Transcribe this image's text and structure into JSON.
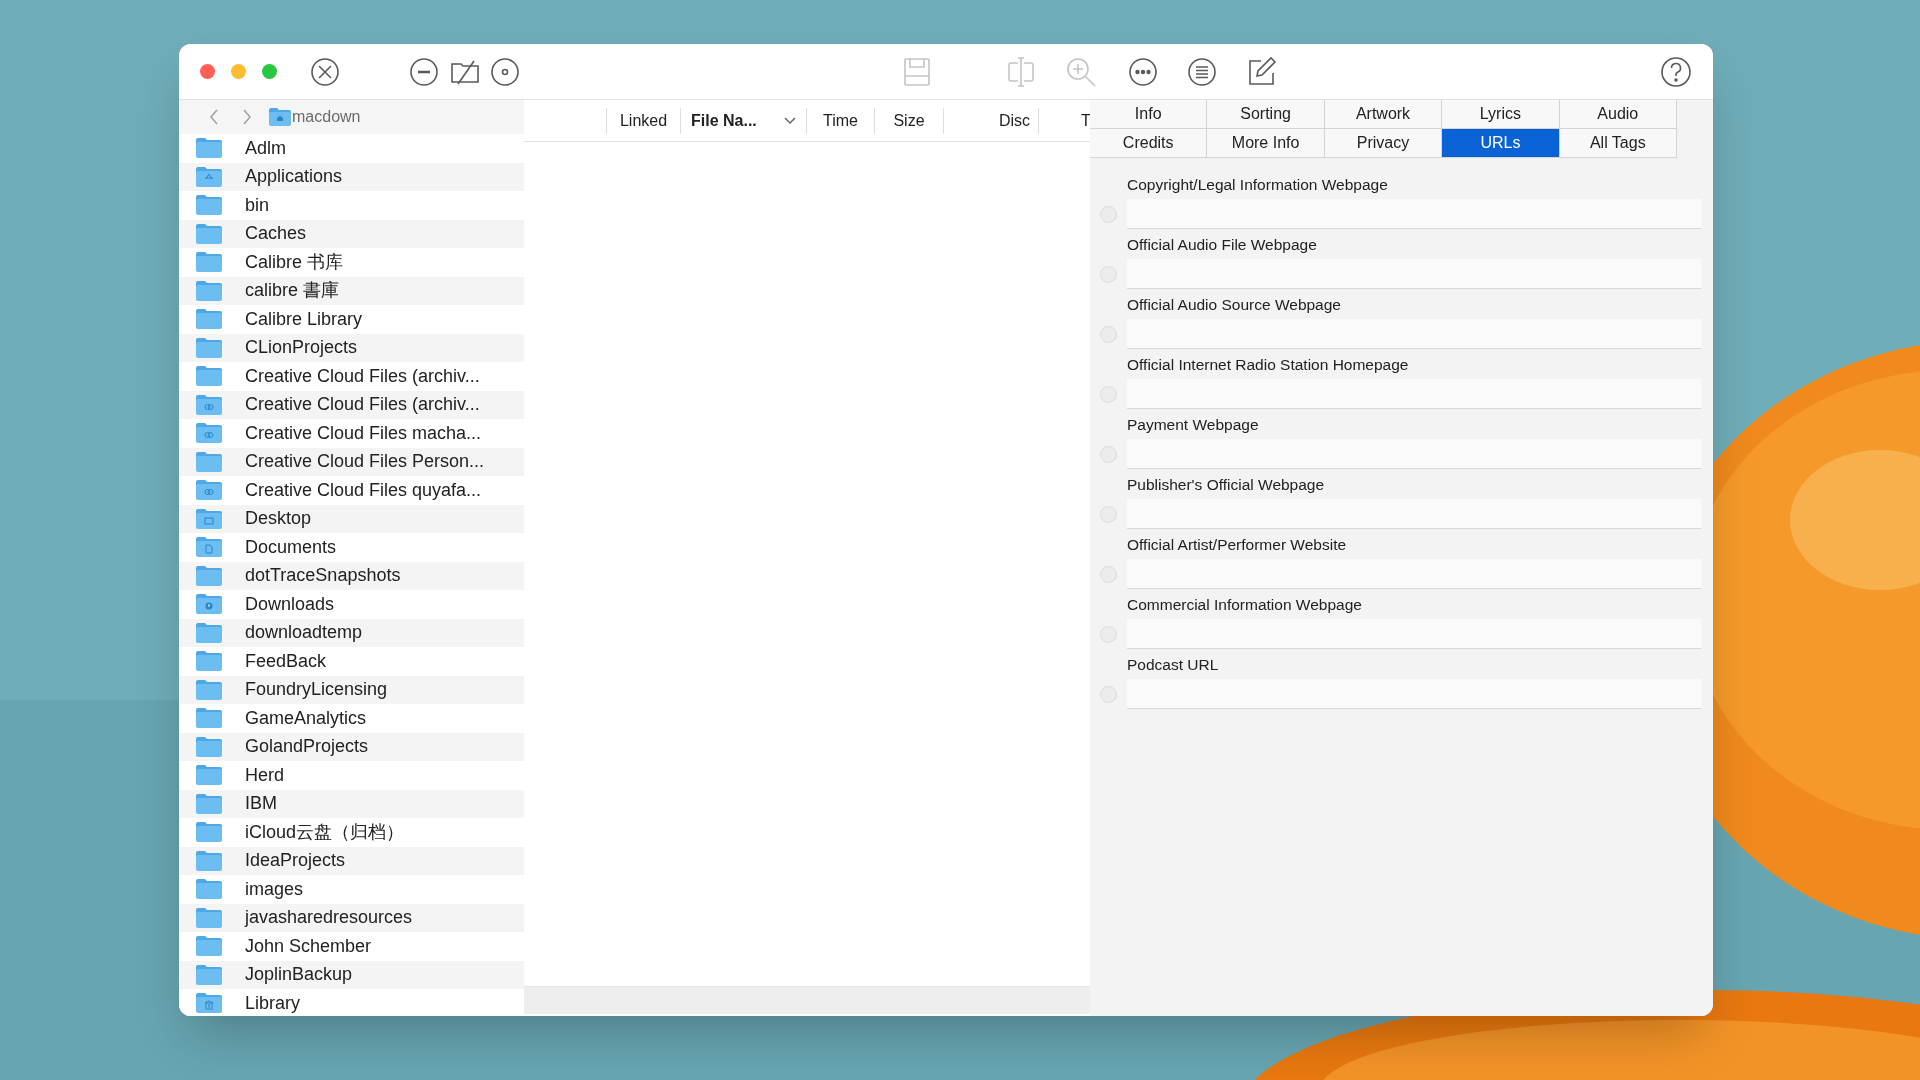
{
  "toolbar": [
    {
      "kind": "close-circle",
      "disabled": false
    },
    {
      "kind": "minus-circle",
      "disabled": false
    },
    {
      "kind": "folder-slash",
      "disabled": false
    },
    {
      "kind": "disc",
      "disabled": false
    },
    {
      "kind": "save",
      "disabled": true
    },
    {
      "kind": "split",
      "disabled": true
    },
    {
      "kind": "zoom",
      "disabled": true
    },
    {
      "kind": "more",
      "disabled": false
    },
    {
      "kind": "list",
      "disabled": false
    },
    {
      "kind": "edit",
      "disabled": false
    },
    {
      "kind": "help",
      "disabled": false
    }
  ],
  "path_bar": {
    "folder": "macdown"
  },
  "sidebar": {
    "items": [
      {
        "label": "Adlm",
        "kind": "folder"
      },
      {
        "label": "Applications",
        "kind": "applications"
      },
      {
        "label": "bin",
        "kind": "folder"
      },
      {
        "label": "Caches",
        "kind": "folder"
      },
      {
        "label": "Calibre 书库",
        "kind": "folder"
      },
      {
        "label": "calibre 書庫",
        "kind": "folder"
      },
      {
        "label": "Calibre Library",
        "kind": "folder"
      },
      {
        "label": "CLionProjects",
        "kind": "folder"
      },
      {
        "label": "Creative Cloud Files (archiv...",
        "kind": "folder"
      },
      {
        "label": "Creative Cloud Files (archiv...",
        "kind": "creative-cloud"
      },
      {
        "label": "Creative Cloud Files macha...",
        "kind": "creative-cloud"
      },
      {
        "label": "Creative Cloud Files Person...",
        "kind": "folder"
      },
      {
        "label": "Creative Cloud Files quyafa...",
        "kind": "creative-cloud"
      },
      {
        "label": "Desktop",
        "kind": "desktop"
      },
      {
        "label": "Documents",
        "kind": "documents"
      },
      {
        "label": "dotTraceSnapshots",
        "kind": "folder"
      },
      {
        "label": "Downloads",
        "kind": "downloads"
      },
      {
        "label": "downloadtemp",
        "kind": "folder"
      },
      {
        "label": "FeedBack",
        "kind": "folder"
      },
      {
        "label": "FoundryLicensing",
        "kind": "folder"
      },
      {
        "label": "GameAnalytics",
        "kind": "folder"
      },
      {
        "label": "GolandProjects",
        "kind": "folder"
      },
      {
        "label": "Herd",
        "kind": "folder"
      },
      {
        "label": "IBM",
        "kind": "folder"
      },
      {
        "label": "iCloud云盘（归档）",
        "kind": "folder"
      },
      {
        "label": "IdeaProjects",
        "kind": "folder"
      },
      {
        "label": "images",
        "kind": "folder"
      },
      {
        "label": "javasharedresources",
        "kind": "folder"
      },
      {
        "label": "John Schember",
        "kind": "folder"
      },
      {
        "label": "JoplinBackup",
        "kind": "folder"
      },
      {
        "label": "Library",
        "kind": "library"
      }
    ]
  },
  "table": {
    "columns": [
      {
        "label": "Linked",
        "sorted": false
      },
      {
        "label": "File Na...",
        "sorted": true
      },
      {
        "label": "Time",
        "sorted": false
      },
      {
        "label": "Size",
        "sorted": false
      },
      {
        "label": "Disc",
        "sorted": false
      },
      {
        "label": "T",
        "sorted": false
      }
    ]
  },
  "tabs": [
    {
      "label": "Info",
      "selected": false
    },
    {
      "label": "Sorting",
      "selected": false
    },
    {
      "label": "Artwork",
      "selected": false
    },
    {
      "label": "Lyrics",
      "selected": false
    },
    {
      "label": "Audio",
      "selected": false
    },
    {
      "label": "Credits",
      "selected": false
    },
    {
      "label": "More Info",
      "selected": false
    },
    {
      "label": "Privacy",
      "selected": false
    },
    {
      "label": "URLs",
      "selected": true
    },
    {
      "label": "All Tags",
      "selected": false
    }
  ],
  "fields": [
    {
      "label": "Copyright/Legal Information Webpage",
      "checked": false
    },
    {
      "label": "Official Audio File Webpage",
      "checked": false
    },
    {
      "label": "Official Audio Source Webpage",
      "checked": false
    },
    {
      "label": "Official Internet Radio Station Homepage",
      "checked": false
    },
    {
      "label": "Payment Webpage",
      "checked": false
    },
    {
      "label": "Publisher's Official Webpage",
      "checked": false
    },
    {
      "label": "Official Artist/Performer Website",
      "checked": false
    },
    {
      "label": "Commercial Information Webpage",
      "checked": false
    },
    {
      "label": "Podcast URL",
      "checked": false
    }
  ]
}
